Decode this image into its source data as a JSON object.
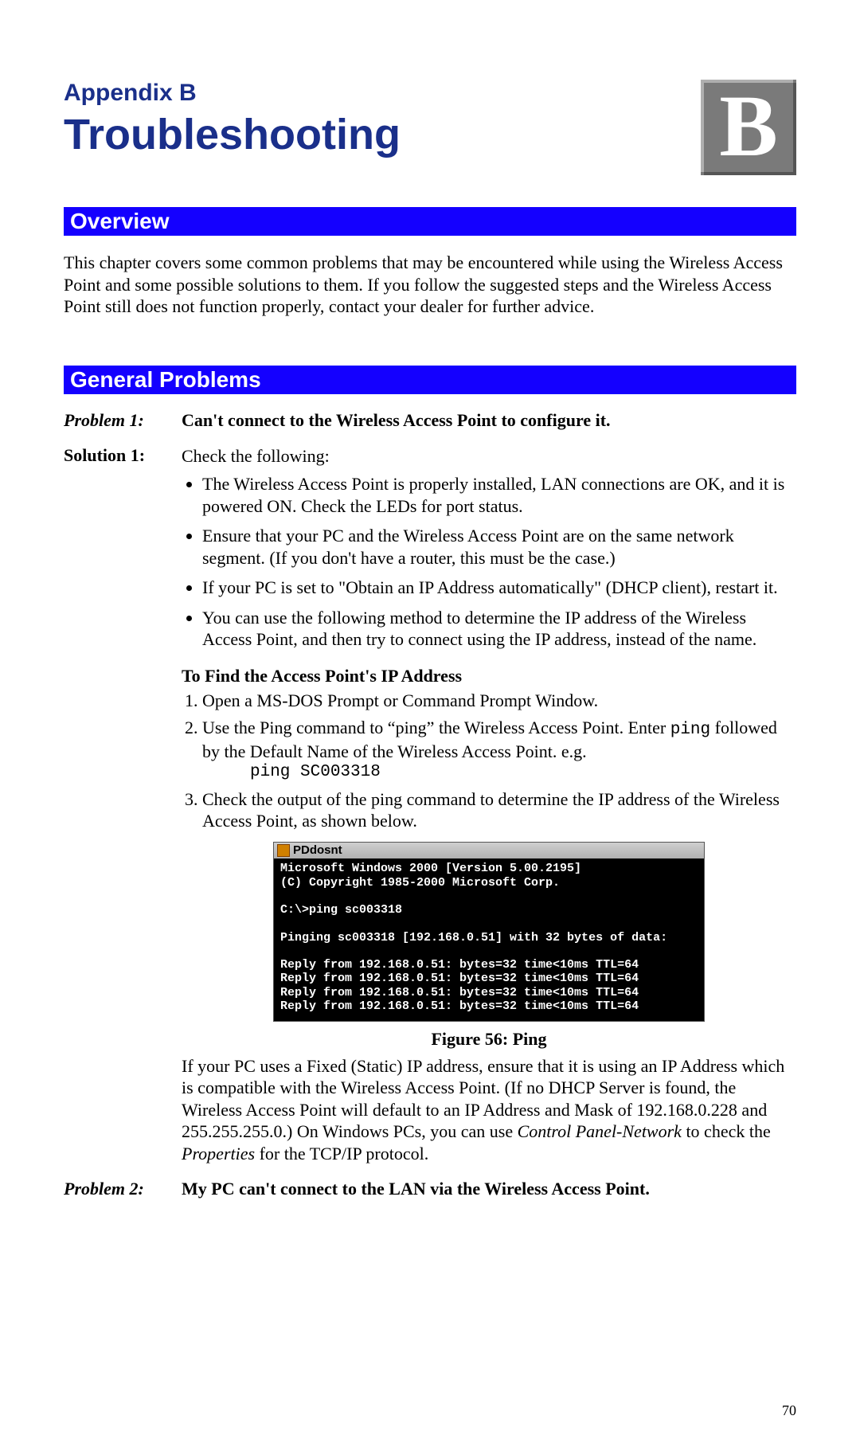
{
  "header": {
    "appendix": "Appendix B",
    "title": "Troubleshooting",
    "badge": "B"
  },
  "overview": {
    "title": "Overview",
    "body": "This chapter covers some common problems that may be encountered while using the Wireless Access Point and some possible solutions to them. If you follow the suggested steps and the Wireless Access Point still does not function properly, contact your dealer for further advice."
  },
  "general": {
    "title": "General Problems",
    "p1_label": "Problem 1:",
    "p1_text": "Can't connect to the Wireless Access Point to configure it.",
    "s1_label": "Solution 1:",
    "s1_intro": "Check the following:",
    "s1_bullets": {
      "b1": "The Wireless Access Point is properly installed, LAN connections are OK, and it is powered ON. Check the LEDs for port status.",
      "b2": "Ensure that your PC and the Wireless Access Point are on the same network segment. (If you don't have a router, this must be the case.)",
      "b3": "If your PC is set to \"Obtain an IP Address automatically\" (DHCP client), restart it.",
      "b4": "You can use the following method to determine the IP address of the Wireless Access Point, and then try to connect using the IP address, instead of the name."
    },
    "find_ip_title": "To Find the Access Point's IP Address",
    "ol": {
      "i1": "Open a MS-DOS Prompt or Command Prompt Window.",
      "i2a": "Use the Ping command to “ping” the Wireless Access Point. Enter ",
      "i2_cmd": "ping",
      "i2b": " followed by the Default Name of the Wireless Access Point. e.g.",
      "i2_example": "ping SC003318",
      "i3": "Check the output of the ping command to determine the IP address of the Wireless Access Point, as shown below."
    },
    "terminal": {
      "title": "PDdosnt",
      "body": "Microsoft Windows 2000 [Version 5.00.2195]\n(C) Copyright 1985-2000 Microsoft Corp.\n\nC:\\>ping sc003318\n\nPinging sc003318 [192.168.0.51] with 32 bytes of data:\n\nReply from 192.168.0.51: bytes=32 time<10ms TTL=64\nReply from 192.168.0.51: bytes=32 time<10ms TTL=64\nReply from 192.168.0.51: bytes=32 time<10ms TTL=64\nReply from 192.168.0.51: bytes=32 time<10ms TTL=64"
    },
    "figure_caption": "Figure 56: Ping",
    "static_note_a": "If your PC uses a Fixed (Static) IP address, ensure that it is using an IP Address which is compatible with the Wireless Access Point. (If no DHCP Server is found, the Wireless Access Point will default to an IP Address and Mask of 192.168.0.228 and 255.255.255.0.) On Windows PCs, you can use ",
    "static_note_i1": "Control Panel-Network",
    "static_note_b": " to check the ",
    "static_note_i2": "Properties",
    "static_note_c": " for the TCP/IP protocol.",
    "p2_label": "Problem 2:",
    "p2_text": "My PC can't connect to the LAN via the Wireless Access Point."
  },
  "page_number": "70"
}
